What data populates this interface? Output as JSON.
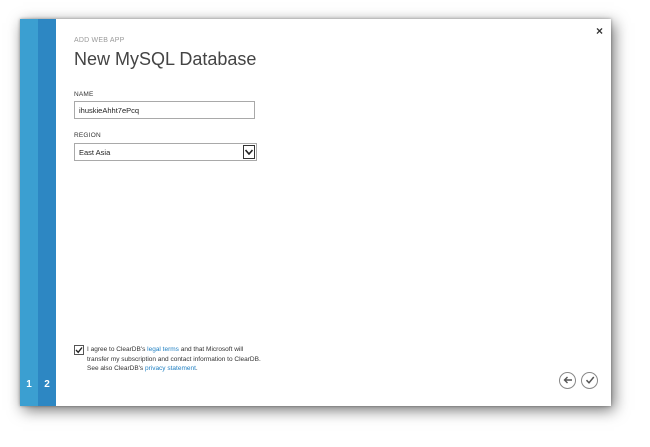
{
  "dialog": {
    "subtitle": "ADD WEB APP",
    "title": "New MySQL Database",
    "close_glyph": "×"
  },
  "steps": [
    "1",
    "2"
  ],
  "form": {
    "name_label": "NAME",
    "name_value": "ihuskieAhht7ePcq",
    "region_label": "REGION",
    "region_value": "East Asia"
  },
  "agreement": {
    "checked": true,
    "text_1": "I agree to ClearDB's ",
    "legal_link": "legal terms",
    "text_2": " and that Microsoft will transfer my subscription and contact information to ClearDB. See also ClearDB's ",
    "privacy_link": "privacy statement",
    "text_3": "."
  },
  "icons": {
    "close": "close-icon",
    "dropdown": "chevron-down-icon",
    "back": "arrow-left-icon",
    "complete": "check-icon"
  },
  "colors": {
    "step_1": "#3b9fd1",
    "step_2": "#2d87c3",
    "link": "#1e7fc2"
  }
}
